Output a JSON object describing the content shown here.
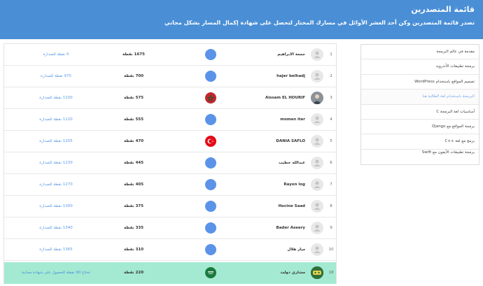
{
  "header": {
    "title": "قائمة المتصدرين",
    "subtitle": "تصدر قائمة المتصدرين وكن أحد العشر الأوائل في مسارك المختار لتحصل على شهادة إكمال المسار بشكل مجاني"
  },
  "leaderboard": {
    "rows": [
      {
        "rank": "1",
        "name": "جمعة الابراهيم",
        "points": "1675 نقطة",
        "gap": "0 نقطة للصدارة",
        "flag": "default-flag-icon",
        "avatar": "placeholder"
      },
      {
        "rank": "2",
        "name": "hajer belhadj",
        "points": "700 نقطة",
        "gap": "975 نقطة للصدارة",
        "flag": "default-flag-icon",
        "avatar": "placeholder"
      },
      {
        "rank": "3",
        "name": "Aissam EL HOURIF",
        "points": "575 نقطة",
        "gap": "1100 نقطة للصدارة",
        "flag": "morocco-flag-icon",
        "avatar": "photo"
      },
      {
        "rank": "4",
        "name": "momen iter",
        "points": "555 نقطة",
        "gap": "1120 نقطة للصدارة",
        "flag": "default-flag-icon",
        "avatar": "placeholder"
      },
      {
        "rank": "5",
        "name": "DANIA SAFLO",
        "points": "470 نقطة",
        "gap": "1205 نقطة للصدارة",
        "flag": "turkey-flag-icon",
        "avatar": "placeholder"
      },
      {
        "rank": "6",
        "name": "عبدالله خطيب",
        "points": "445 نقطة",
        "gap": "1230 نقطة للصدارة",
        "flag": "default-flag-icon",
        "avatar": "placeholder"
      },
      {
        "rank": "7",
        "name": "Rayon log",
        "points": "405 نقطة",
        "gap": "1270 نقطة للصدارة",
        "flag": "default-flag-icon",
        "avatar": "placeholder"
      },
      {
        "rank": "8",
        "name": "Hocine Saad",
        "points": "375 نقطة",
        "gap": "1300 نقطة للصدارة",
        "flag": "default-flag-icon",
        "avatar": "placeholder"
      },
      {
        "rank": "9",
        "name": "Bader Aseery",
        "points": "335 نقطة",
        "gap": "1340 نقطة للصدارة",
        "flag": "default-flag-icon",
        "avatar": "placeholder"
      },
      {
        "rank": "10",
        "name": "ميار هلال",
        "points": "310 نقطة",
        "gap": "1365 نقطة للصدارة",
        "flag": "default-flag-icon",
        "avatar": "placeholder"
      }
    ],
    "current_user": {
      "rank": "18",
      "name": "مشاري دولت",
      "points": "220 نقطة",
      "gap": "تحتاج 90 نقطة للحصول على شهادة مجانية",
      "flag": "saudi-flag-icon",
      "avatar": "game-logo"
    }
  },
  "tracks": {
    "items": [
      "مقدمة في عالم البرمجة",
      "برمجة تطبيقات الأندرويد",
      "تصميم المواقع باستخدام WordPress",
      "البرمجة باستخدام لغة الطالبة هنا",
      "أساسيات لغة البرمجة C",
      "برمجة المواقع مع Django",
      "برمج مع لغة ++C",
      "برمجة تطبيقات الأيفون مع Swift"
    ],
    "active_index": 3
  },
  "colors": {
    "banner": "#4a8fd6",
    "gap_text": "#5b9ae3",
    "current_user_row": "#a4ead2",
    "default_flag": "#5b93e8"
  }
}
